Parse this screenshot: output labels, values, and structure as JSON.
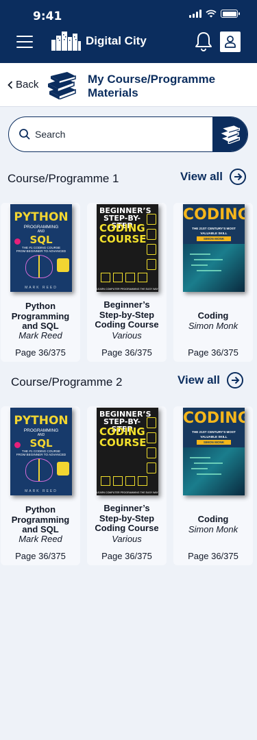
{
  "status_bar": {
    "time": "9:41"
  },
  "app": {
    "title": "Digital City"
  },
  "header": {
    "back_label": "Back",
    "page_title_line1": "My Course/Programme",
    "page_title_line2": "Materials"
  },
  "search": {
    "placeholder": "Search"
  },
  "sections": [
    {
      "title": "Course/Programme 1",
      "view_all_label": "View all",
      "books": [
        {
          "title_lines": [
            "Python",
            "Programming",
            "and SQL"
          ],
          "author": "Mark Reed",
          "page": "Page 36/375"
        },
        {
          "title_lines": [
            "Beginner’s",
            "Step-by-Step",
            "Coding Course"
          ],
          "author": "Various",
          "page": "Page 36/375"
        },
        {
          "title_lines": [
            "Coding"
          ],
          "author": "Simon Monk",
          "page": "Page 36/375"
        }
      ]
    },
    {
      "title": "Course/Programme 2",
      "view_all_label": "View all",
      "books": [
        {
          "title_lines": [
            "Python",
            "Programming",
            "and SQL"
          ],
          "author": "Mark Reed",
          "page": "Page 36/375"
        },
        {
          "title_lines": [
            "Beginner’s",
            "Step-by-Step",
            "Coding Course"
          ],
          "author": "Various",
          "page": "Page 36/375"
        },
        {
          "title_lines": [
            "Coding"
          ],
          "author": "Simon Monk",
          "page": "Page 36/375"
        }
      ]
    }
  ],
  "covers": {
    "python": {
      "line1": "PYTHON",
      "line2": "PROGRAMMING",
      "line3": "AND",
      "line4": "SQL",
      "line5": "THE #1 CODING COURSE",
      "line6": "FROM BEGINNER TO ADVANCED",
      "author": "MARK REED"
    },
    "beginner": {
      "line1": "BEGINNER’S",
      "line2": "STEP-BY-STEP",
      "line3": "CODING",
      "line4": "COURSE",
      "foot": "LEARN COMPUTER PROGRAMMING THE EASY WAY"
    },
    "coding": {
      "line1": "CODING",
      "line2": "THE 21ST CENTURY’S MOST",
      "line3": "VALUABLE SKILL",
      "line4": "SIMON MONK"
    }
  },
  "colors": {
    "primary": "#0b2d5e",
    "background": "#eef2f8",
    "card": "#f6f8fc"
  }
}
